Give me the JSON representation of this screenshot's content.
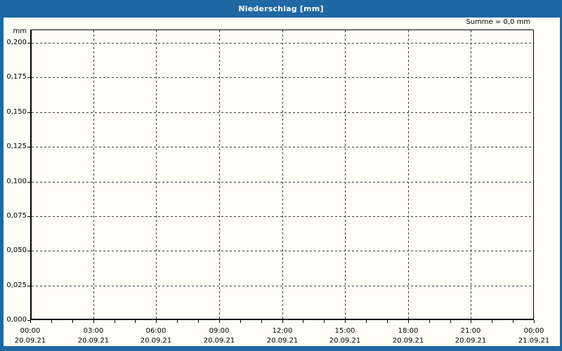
{
  "window": {
    "title": "Niederschlag [mm]"
  },
  "colors": {
    "accent_blue": "#1e68a4",
    "panel_background": "#fdfdf6",
    "grid": "#3d3d3d",
    "axis": "#000000",
    "title_text": "#ffffff"
  },
  "chart_data": {
    "type": "line",
    "title": "Niederschlag [mm]",
    "unit_label": "mm",
    "sum_annotation": "Summe = 0,0 mm",
    "grid": "dashed",
    "legend_position": "none",
    "ylim": [
      0.0,
      0.21
    ],
    "y_ticks": {
      "labels": [
        "0,200",
        "0,175",
        "0,150",
        "0,125",
        "0,100",
        "0,075",
        "0,050",
        "0,025",
        "0,000"
      ],
      "values": [
        0.2,
        0.175,
        0.15,
        0.125,
        0.1,
        0.075,
        0.05,
        0.025,
        0.0
      ]
    },
    "x_range_hours": 24,
    "x_major_tick_interval_hours": 3,
    "x_minor_tick_interval_hours": 1,
    "x_ticks": [
      {
        "time": "00:00",
        "date": "20.09.21"
      },
      {
        "time": "03:00",
        "date": "20.09.21"
      },
      {
        "time": "06:00",
        "date": "20.09.21"
      },
      {
        "time": "09:00",
        "date": "20.09.21"
      },
      {
        "time": "12:00",
        "date": "20.09.21"
      },
      {
        "time": "15:00",
        "date": "20.09.21"
      },
      {
        "time": "18:00",
        "date": "20.09.21"
      },
      {
        "time": "21:00",
        "date": "20.09.21"
      },
      {
        "time": "00:00",
        "date": "21.09.21"
      }
    ],
    "series": [
      {
        "name": "Niederschlag",
        "values": [],
        "total_mm": 0.0
      }
    ]
  }
}
